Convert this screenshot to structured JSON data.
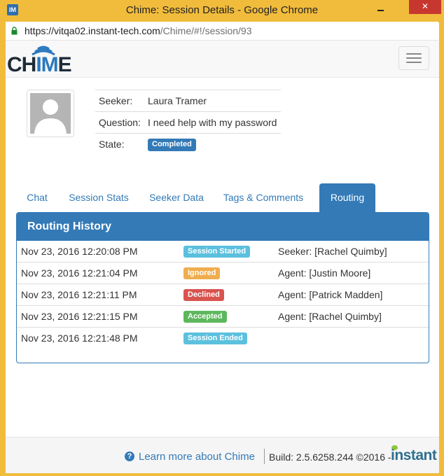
{
  "window": {
    "title": "Chime: Session Details - Google Chrome",
    "app_icon_text": "IM",
    "close_glyph": "✕"
  },
  "address_bar": {
    "url_host": "https://vitqa02.instant-tech.com",
    "url_path": "/Chime/#!/session/93"
  },
  "navbar": {
    "logo_text_dark": "CH",
    "logo_text_blue": "IM",
    "logo_text_dark2": "E"
  },
  "session": {
    "seeker_label": "Seeker:",
    "seeker_value": "Laura Tramer",
    "question_label": "Question:",
    "question_value": "I need help with my password",
    "state_label": "State:",
    "state_value": "Completed"
  },
  "tabs": [
    {
      "label": "Chat",
      "active": false
    },
    {
      "label": "Session Stats",
      "active": false
    },
    {
      "label": "Seeker Data",
      "active": false
    },
    {
      "label": "Tags & Comments",
      "active": false
    },
    {
      "label": "Routing",
      "active": true
    }
  ],
  "routing": {
    "title": "Routing History",
    "rows": [
      {
        "time": "Nov 23, 2016 12:20:08 PM",
        "status": "Session Started",
        "color": "#5bc0de",
        "who": "Seeker: [Rachel Quimby]"
      },
      {
        "time": "Nov 23, 2016 12:21:04 PM",
        "status": "Ignored",
        "color": "#f0ad4e",
        "who": "Agent: [Justin Moore]"
      },
      {
        "time": "Nov 23, 2016 12:21:11 PM",
        "status": "Declined",
        "color": "#d9534f",
        "who": "Agent: [Patrick Madden]"
      },
      {
        "time": "Nov 23, 2016 12:21:15 PM",
        "status": "Accepted",
        "color": "#5cb85c",
        "who": "Agent: [Rachel Quimby]"
      },
      {
        "time": "Nov 23, 2016 12:21:48 PM",
        "status": "Session Ended",
        "color": "#5bc0de",
        "who": ""
      }
    ]
  },
  "footer": {
    "help_glyph": "?",
    "learn_more": "Learn more about Chime",
    "build": "Build: 2.5.6258.244 ©2016 -",
    "brand": "instant"
  },
  "colors": {
    "primary": "#337ab7",
    "window_frame": "#f1bc3c"
  }
}
